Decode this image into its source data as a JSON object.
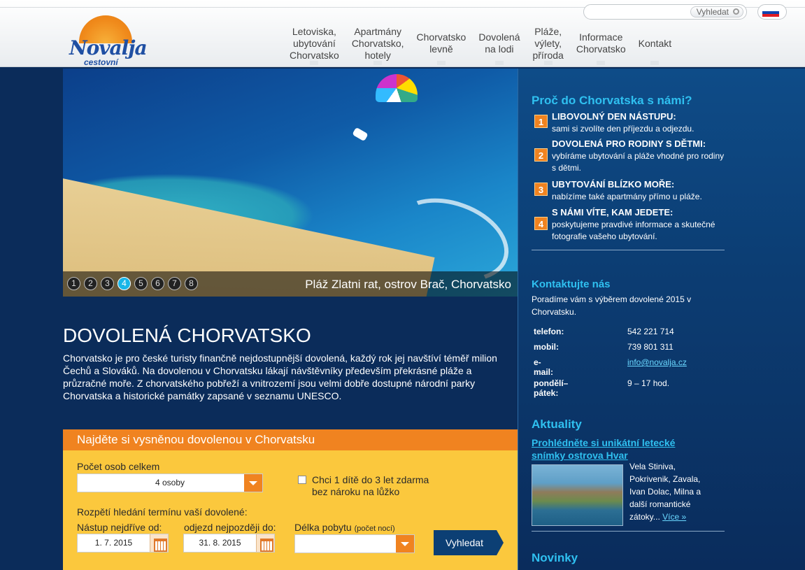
{
  "header": {
    "logo_name": "Novalja",
    "logo_sub": "cestovní kancelář",
    "search_button": "Vyhledat",
    "flag_icon": "slovak-flag-icon",
    "nav": [
      {
        "label": "Letoviska,\nubytování\nChorvatsko"
      },
      {
        "label": "Apartmány\nChorvatsko,\nhotely"
      },
      {
        "label": "Chorvatsko\nlevně"
      },
      {
        "label": "Dovolená\nna lodi"
      },
      {
        "label": "Pláže,\nvýlety,\npříroda"
      },
      {
        "label": "Informace\nChorvatsko"
      },
      {
        "label": "Kontakt"
      }
    ]
  },
  "hero": {
    "caption": "Pláž Zlatni rat, ostrov Brač, Chorvatsko",
    "dots": [
      "1",
      "2",
      "3",
      "4",
      "5",
      "6",
      "7",
      "8"
    ],
    "active_dot": "4"
  },
  "intro": {
    "title": "DOVOLENÁ CHORVATSKO",
    "text": "Chorvatsko je pro české turisty finančně nejdostupnější dovolená, každý rok jej navštíví téměř milion Čechů a Slováků. Na dovolenou v Chorvatsku lákají návštěvníky především překrásné pláže a průzračné moře. Z chorvatského pobřeží a vnitrozemí jsou velmi dobře dostupné národní parky Chorvatska a historické památky zapsané v seznamu UNESCO."
  },
  "search_form": {
    "heading": "Najděte si vysněnou dovolenou v Chorvatsku",
    "persons_label": "Počet osob celkem",
    "persons_value": "4 osoby",
    "child_label_1": "Chci 1 dítě do 3 let zdarma",
    "child_label_2": "bez nároku na lůžko",
    "range_label": "Rozpětí hledání termínu vaší dovolené:",
    "from_label": "Nástup nejdříve od:",
    "from_value": "1. 7. 2015",
    "to_label": "odjezd nejpozději do:",
    "to_value": "31. 8. 2015",
    "length_label": "Délka pobytu",
    "length_hint": "(počet nocí)",
    "length_value": "",
    "submit": "Vyhledat"
  },
  "sidebar": {
    "why_title": "Proč do Chorvatska s námi?",
    "why": [
      {
        "num": "1",
        "title": "LIBOVOLNÝ DEN NÁSTUPU:",
        "desc": "sami si zvolíte den příjezdu a odjezdu."
      },
      {
        "num": "2",
        "title": "DOVOLENÁ PRO RODINY S DĚTMI:",
        "desc": "vybíráme ubytování a pláže vhodné pro rodiny s dětmi."
      },
      {
        "num": "3",
        "title": "UBYTOVÁNÍ BLÍZKO MOŘE:",
        "desc": "nabízíme také apartmány přímo u pláže."
      },
      {
        "num": "4",
        "title": "S NÁMI VÍTE, KAM JEDETE:",
        "desc": "poskytujeme pravdivé informace a skutečné fotografie vašeho ubytování."
      }
    ],
    "contact_title": "Kontaktujte nás",
    "contact_intro": "Poradíme vám s výběrem dovolené 2015 v Chorvatsku.",
    "contact": [
      {
        "k": "telefon:",
        "v": "542 221 714"
      },
      {
        "k": "mobil:",
        "v": "739 801 311"
      },
      {
        "k": "e-mail:",
        "v": "info@novalja.cz"
      },
      {
        "k": "pondělí–pátek:",
        "v": "9 – 17 hod."
      }
    ],
    "news_title": "Aktuality",
    "news_link": "Prohlédněte si unikátní letecké snímky ostrova Hvar",
    "news_text": "Vela Stiniva, Pokrivenik, Zavala, Ivan Dolac, Milna a další romantické zátoky...",
    "news_more": "Více »",
    "novinky": "Novinky"
  }
}
